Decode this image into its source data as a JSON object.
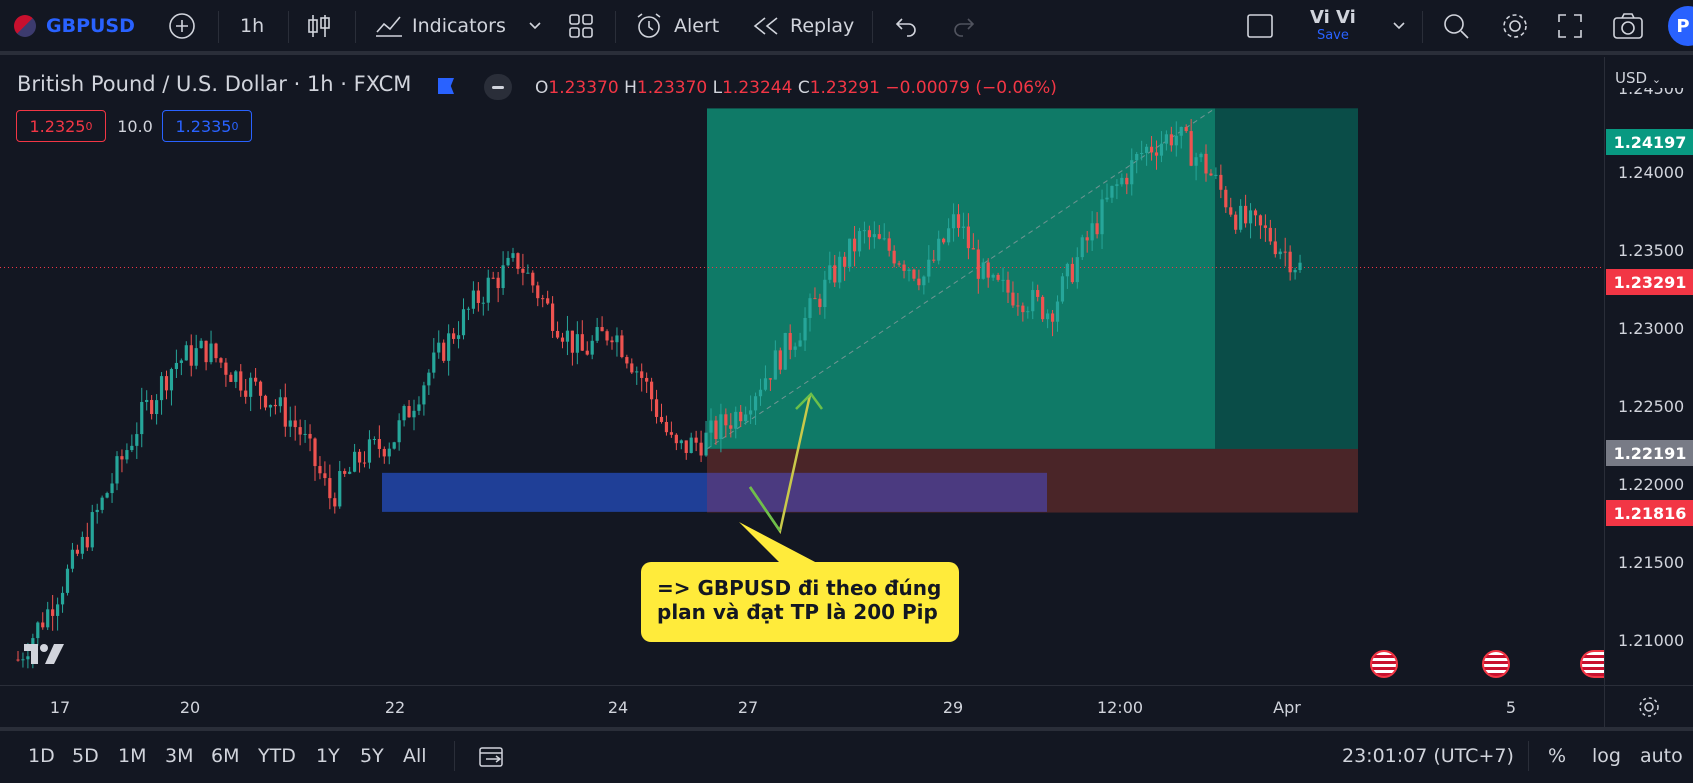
{
  "topbar": {
    "symbol": "GBPUSD",
    "interval": "1h",
    "indicators_label": "Indicators",
    "alert_label": "Alert",
    "replay_label": "Replay",
    "layout_name": "Vi Vi",
    "save_label": "Save",
    "profile_initial": "P"
  },
  "legend": {
    "title": "British Pound / U.S. Dollar · 1h · FXCM",
    "open_key": "O",
    "open": "1.23370",
    "high_key": "H",
    "high": "1.23370",
    "low_key": "L",
    "low": "1.23244",
    "close_key": "C",
    "close": "1.23291",
    "change": "−0.00079 (−0.06%)",
    "sell_price": "1.2325",
    "sell_price_sup": "0",
    "spread": "10.0",
    "buy_price": "1.2335",
    "buy_price_sup": "0"
  },
  "price_axis": {
    "currency": "USD",
    "ticks": [
      "1.24500",
      "1.24000",
      "1.23500",
      "1.23000",
      "1.22500",
      "1.22000",
      "1.21500",
      "1.21000"
    ],
    "tags": {
      "take_profit": "1.24197",
      "current": "1.23291",
      "entry": "1.22191",
      "stop_loss": "1.21816"
    }
  },
  "time_axis": {
    "labels": [
      "17",
      "20",
      "22",
      "24",
      "27",
      "29",
      "12:00",
      "Apr",
      "5"
    ]
  },
  "annotation": {
    "line1": "=> GBPUSD đi theo đúng",
    "line2": "plan và đạt TP là 200 Pip"
  },
  "bottombar": {
    "ranges": [
      "1D",
      "5D",
      "1M",
      "3M",
      "6M",
      "YTD",
      "1Y",
      "5Y",
      "All"
    ],
    "clock": "23:01:07 (UTC+7)",
    "percent": "%",
    "log": "log",
    "auto": "auto"
  },
  "colors": {
    "bg": "#131722",
    "up": "#26a69a",
    "down": "#ef5350",
    "profit_zone": "#0f7a67",
    "loss_zone": "#4a2528",
    "demand_zone": "#1f3f97",
    "callout": "#ffeb3b",
    "accent": "#2962ff"
  },
  "chart_data": {
    "type": "candlestick",
    "symbol": "GBPUSD",
    "interval": "1h",
    "approx_closes": [
      1.2095,
      1.2125,
      1.216,
      1.22,
      1.224,
      1.227,
      1.2278,
      1.2262,
      1.225,
      1.223,
      1.219,
      1.2215,
      1.2225,
      1.226,
      1.229,
      1.2315,
      1.233,
      1.23,
      1.2275,
      1.229,
      1.226,
      1.2218,
      1.2225,
      1.224,
      1.2265,
      1.229,
      1.232,
      1.2345,
      1.2335,
      1.232,
      1.2355,
      1.2315,
      1.231,
      1.23,
      1.2335,
      1.237,
      1.2395,
      1.2405,
      1.2385,
      1.2355,
      1.2345,
      1.2326
    ],
    "position": {
      "side": "long",
      "entry": 1.22191,
      "take_profit": 1.24197,
      "stop_loss": 1.21816
    },
    "demand_zone": [
      1.2182,
      1.2205
    ],
    "ylim": [
      1.208,
      1.245
    ]
  }
}
